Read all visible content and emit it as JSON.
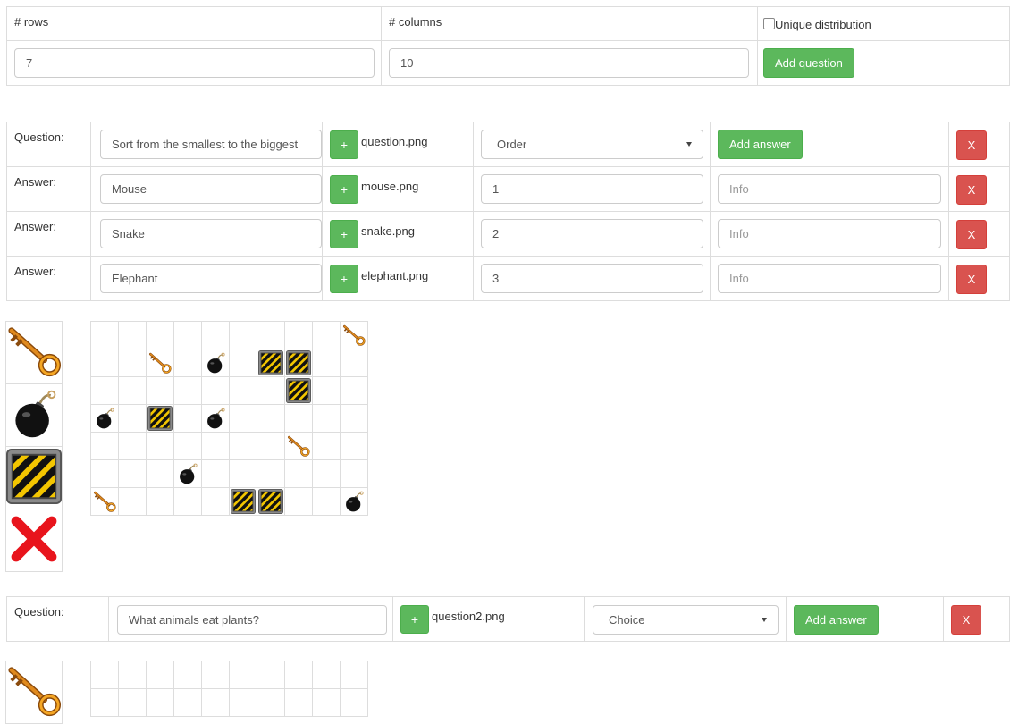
{
  "config": {
    "rows_label": "# rows",
    "columns_label": "# columns",
    "unique_label": "Unique distribution",
    "rows_value": "7",
    "columns_value": "10",
    "add_question": "Add question"
  },
  "question1": {
    "label": "Question:",
    "text": "Sort from the smallest to the biggest",
    "image": "question.png",
    "type": "Order",
    "add_answer": "Add answer",
    "answers": [
      {
        "label": "Answer:",
        "text": "Mouse",
        "image": "mouse.png",
        "value": "1",
        "info_placeholder": "Info"
      },
      {
        "label": "Answer:",
        "text": "Snake",
        "image": "snake.png",
        "value": "2",
        "info_placeholder": "Info"
      },
      {
        "label": "Answer:",
        "text": "Elephant",
        "image": "elephant.png",
        "value": "3",
        "info_placeholder": "Info"
      }
    ]
  },
  "question2": {
    "label": "Question:",
    "text": "What animals eat plants?",
    "image": "question2.png",
    "type": "Choice",
    "add_answer": "Add answer"
  },
  "buttons": {
    "plus": "+",
    "delete": "X"
  },
  "palette": [
    "key-icon",
    "bomb-icon",
    "hazard-block-icon",
    "red-x-icon"
  ],
  "board1": {
    "rows": 7,
    "cols": 10,
    "cells": [
      [
        0,
        9,
        "key"
      ],
      [
        1,
        2,
        "key"
      ],
      [
        1,
        4,
        "bomb"
      ],
      [
        1,
        6,
        "block"
      ],
      [
        1,
        7,
        "block"
      ],
      [
        2,
        7,
        "block"
      ],
      [
        3,
        0,
        "bomb"
      ],
      [
        3,
        2,
        "block"
      ],
      [
        3,
        4,
        "bomb"
      ],
      [
        4,
        7,
        "key"
      ],
      [
        5,
        3,
        "bomb"
      ],
      [
        6,
        0,
        "key"
      ],
      [
        6,
        5,
        "block"
      ],
      [
        6,
        6,
        "block"
      ],
      [
        6,
        9,
        "bomb"
      ]
    ]
  }
}
